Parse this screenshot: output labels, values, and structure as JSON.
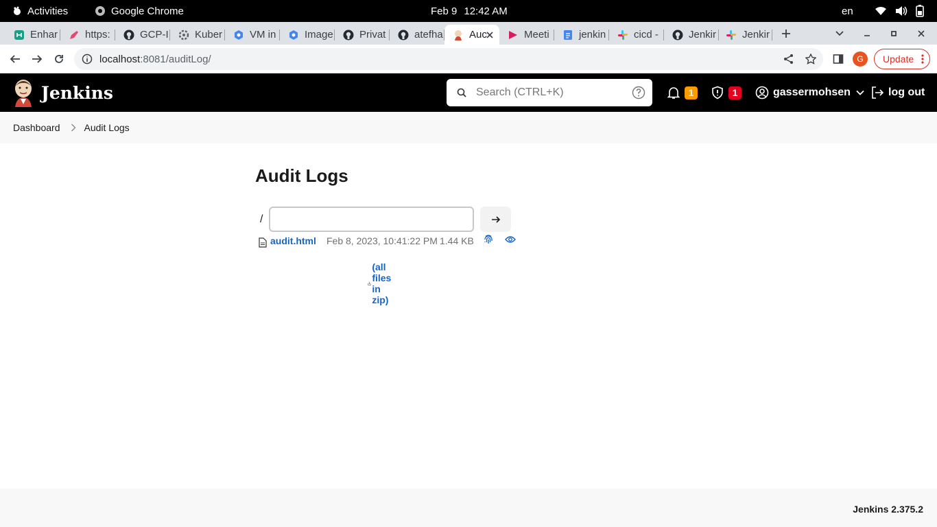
{
  "system_bar": {
    "activities": "Activities",
    "app_name": "Google Chrome",
    "date": "Feb 9",
    "time": "12:42 AM",
    "language": "en"
  },
  "tabs": [
    {
      "label": "Enhar",
      "icon": "bracket-icon",
      "color": "#16a085"
    },
    {
      "label": "https:",
      "icon": "pen-icon",
      "color": "#e8466f"
    },
    {
      "label": "GCP-I",
      "icon": "github-icon",
      "color": "#24292f"
    },
    {
      "label": "Kuber",
      "icon": "gear-icon",
      "color": "#5f6368"
    },
    {
      "label": "VM in",
      "icon": "cloud-icon",
      "color": "#4285f4"
    },
    {
      "label": "Image",
      "icon": "cloud-icon",
      "color": "#4285f4"
    },
    {
      "label": "Privat",
      "icon": "github-icon",
      "color": "#24292f"
    },
    {
      "label": "atefha",
      "icon": "github-icon",
      "color": "#24292f"
    },
    {
      "label": "Auc",
      "icon": "jenkins-icon",
      "color": "#d24939",
      "active": true
    },
    {
      "label": "Meeti",
      "icon": "play-icon",
      "color": "#d81b60"
    },
    {
      "label": "jenkin",
      "icon": "docs-icon",
      "color": "#4285f4"
    },
    {
      "label": "cicd -",
      "icon": "slack-icon",
      "color": "#e01e5a"
    },
    {
      "label": "Jenkir",
      "icon": "github-icon",
      "color": "#24292f"
    },
    {
      "label": "Jenkir",
      "icon": "slack-icon",
      "color": "#36c5f0"
    }
  ],
  "omnibox": {
    "host": "localhost",
    "rest": ":8081/auditLog/"
  },
  "profile_initial": "G",
  "update_label": "Update",
  "jenkins": {
    "title": "Jenkins",
    "search_placeholder": "Search (CTRL+K)",
    "notifications_count": "1",
    "security_count": "1",
    "username": "gassermohsen",
    "logout": "log out",
    "colors": {
      "notify": "#fe9b00",
      "security": "#e6001f",
      "link": "#1764c6"
    }
  },
  "breadcrumb": [
    "Dashboard",
    "Audit Logs"
  ],
  "page": {
    "title": "Audit Logs",
    "path_prefix": "/",
    "path_value": "",
    "files": [
      {
        "name": "audit.html",
        "date": "Feb 8, 2023, 10:41:22 PM",
        "size": "1.44 KB"
      }
    ],
    "zip_link": "(all files in zip)"
  },
  "footer": {
    "version": "Jenkins 2.375.2"
  }
}
